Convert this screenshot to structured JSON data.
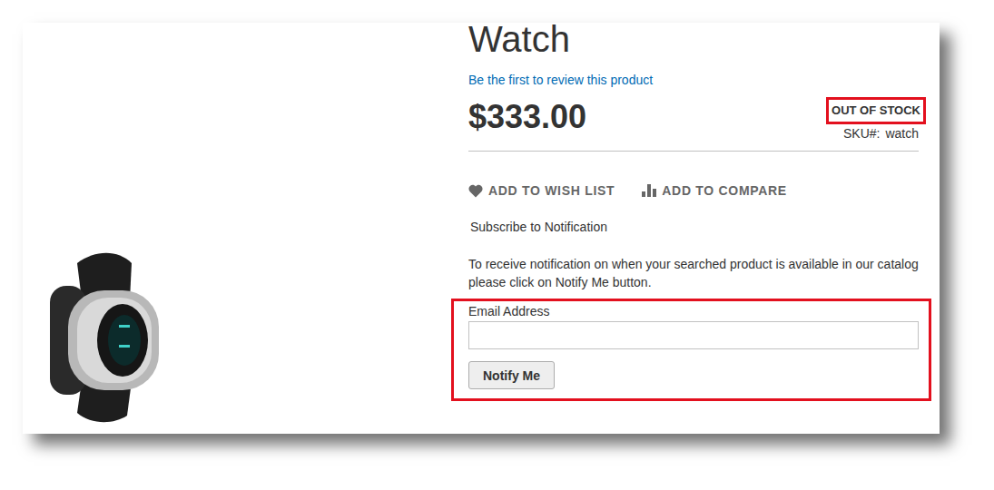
{
  "product": {
    "title": "Watch",
    "review_link": "Be the first to review this product",
    "price": "$333.00",
    "stock": {
      "label": "OUT OF STOCK",
      "highlighted": true
    },
    "sku_label": "SKU#:",
    "sku": "watch"
  },
  "actions": [
    {
      "label": "ADD TO WISH LIST",
      "kind": "wishlist"
    },
    {
      "label": "ADD TO COMPARE",
      "kind": "compare"
    }
  ],
  "notification": {
    "heading": "Subscribe to Notification",
    "description": "To receive notification on when your searched product is available in our catalog please click on Notify Me button.",
    "highlighted": true,
    "field_label": "Email Address",
    "field_value": "",
    "button": "Notify Me"
  }
}
